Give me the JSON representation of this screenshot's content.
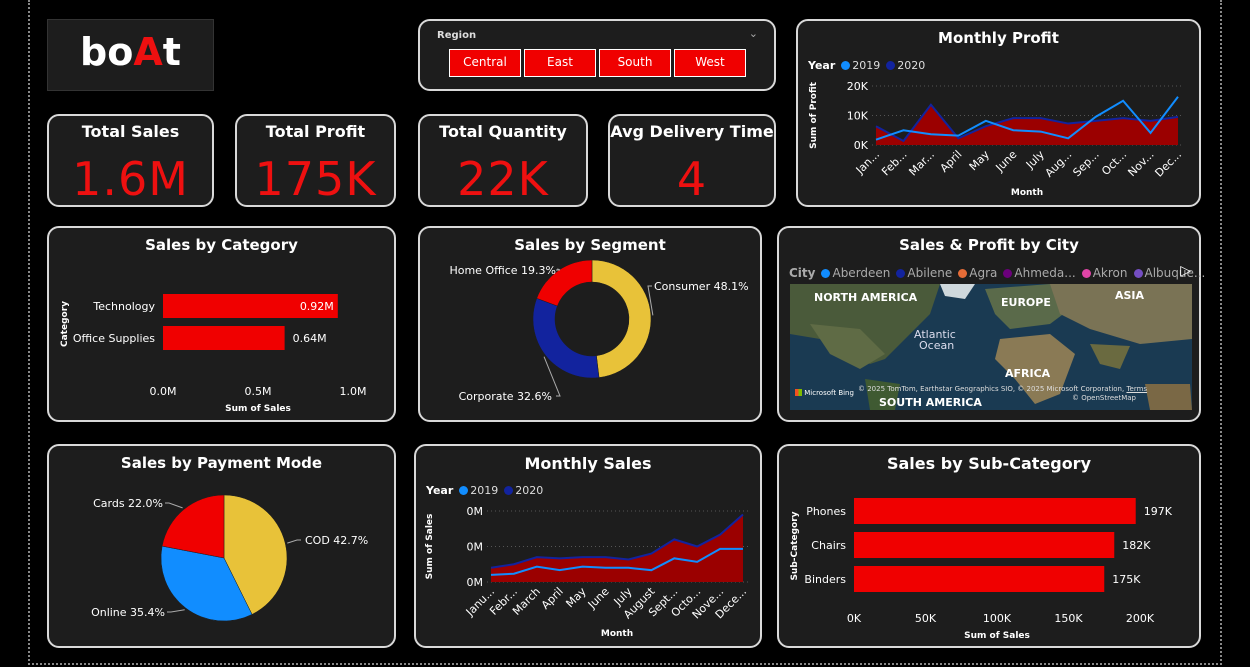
{
  "colors": {
    "red": "#f00000",
    "blue_2019": "#118dff",
    "navy_2020": "#12239e",
    "yellow": "#e8c239",
    "card_bg": "#1d1d1d"
  },
  "logo": {
    "prefix": "bo",
    "accent": "A",
    "suffix": "t"
  },
  "region": {
    "title": "Region",
    "options": [
      "Central",
      "East",
      "South",
      "West"
    ],
    "chevron": "chevron-down-icon"
  },
  "kpis": [
    {
      "label": "Total Sales",
      "value": "1.6M"
    },
    {
      "label": "Total Profit",
      "value": "175K"
    },
    {
      "label": "Total Quantity",
      "value": "22K"
    },
    {
      "label": "Avg Delivery Time",
      "value": "4"
    }
  ],
  "monthly_profit": {
    "title": "Monthly Profit",
    "legend_title": "Year",
    "ylabel": "Sum of Profit",
    "xlabel": "Month"
  },
  "sales_category": {
    "title": "Sales by Category",
    "ylabel": "Category",
    "xlabel": "Sum of Sales"
  },
  "sales_segment": {
    "title": "Sales by Segment"
  },
  "city": {
    "title": "Sales & Profit by City",
    "legend_title": "City",
    "legend": [
      {
        "name": "Aberdeen",
        "color": "#118dff"
      },
      {
        "name": "Abilene",
        "color": "#12239e"
      },
      {
        "name": "Agra",
        "color": "#e66c37"
      },
      {
        "name": "Ahmeda...",
        "color": "#6b007b"
      },
      {
        "name": "Akron",
        "color": "#e044a7"
      },
      {
        "name": "Albuque...",
        "color": "#744ec2"
      }
    ],
    "map_labels": [
      "NORTH AMERICA",
      "EUROPE",
      "ASIA",
      "Atlantic",
      "Ocean",
      "AFRICA",
      "SOUTH AMERICA"
    ],
    "attribution": "© 2025 TomTom, Earthstar Geographics SIO, © 2025 Microsoft Corporation,",
    "terms": "Terms",
    "osm": "© OpenStreetMap",
    "bing": "Microsoft Bing",
    "next_icon": "play-arrow-icon"
  },
  "payment": {
    "title": "Sales by Payment Mode"
  },
  "monthly_sales": {
    "title": "Monthly Sales",
    "legend_title": "Year",
    "ylabel": "Sum of Sales",
    "xlabel": "Month"
  },
  "subcategory": {
    "title": "Sales by Sub-Category",
    "ylabel": "Sub-Category",
    "xlabel": "Sum of Sales"
  },
  "chart_data": [
    {
      "id": "monthly_profit",
      "type": "area",
      "categories": [
        "Jan...",
        "Feb...",
        "Mar...",
        "April",
        "May",
        "June",
        "July",
        "Aug...",
        "Sep...",
        "Oct...",
        "Nov...",
        "Dec..."
      ],
      "series": [
        {
          "name": "2019",
          "values": [
            2000,
            5500,
            4000,
            3500,
            9000,
            5500,
            5000,
            2500,
            10500,
            16500,
            4500,
            18000
          ]
        },
        {
          "name": "2020",
          "values": [
            7000,
            1500,
            15000,
            2500,
            7000,
            10000,
            10000,
            8000,
            9000,
            10000,
            9000,
            10500
          ]
        }
      ],
      "yticks": [
        "0K",
        "10K",
        "20K"
      ],
      "ylim": [
        0,
        22000
      ],
      "title": "Monthly Profit",
      "xlabel": "Month",
      "ylabel": "Sum of Profit"
    },
    {
      "id": "sales_by_category",
      "type": "bar",
      "categories": [
        "Technology",
        "Office Supplies"
      ],
      "values": [
        0.92,
        0.64
      ],
      "value_labels": [
        "0.92M",
        "0.64M"
      ],
      "xticks": [
        "0.0M",
        "0.5M",
        "1.0M"
      ],
      "xlim": [
        0,
        1.0
      ],
      "title": "Sales by Category",
      "xlabel": "Sum of Sales",
      "ylabel": "Category"
    },
    {
      "id": "sales_by_segment",
      "type": "pie",
      "donut": true,
      "labels": [
        "Consumer",
        "Corporate",
        "Home Office"
      ],
      "values": [
        48.1,
        32.6,
        19.3
      ],
      "value_labels": [
        "Consumer 48.1%",
        "Corporate 32.6%",
        "Home Office 19.3%"
      ],
      "title": "Sales by Segment"
    },
    {
      "id": "sales_by_payment_mode",
      "type": "pie",
      "labels": [
        "COD",
        "Online",
        "Cards"
      ],
      "values": [
        42.7,
        35.4,
        22.0
      ],
      "value_labels": [
        "COD 42.7%",
        "Online 35.4%",
        "Cards 22.0%"
      ],
      "title": "Sales by Payment Mode"
    },
    {
      "id": "monthly_sales",
      "type": "area",
      "categories": [
        "Janu...",
        "Febr...",
        "March",
        "April",
        "May",
        "June",
        "July",
        "August",
        "Sept...",
        "Octo...",
        "Nove...",
        "Dece..."
      ],
      "series": [
        {
          "name": "2019",
          "values": [
            0.06,
            0.07,
            0.13,
            0.1,
            0.13,
            0.12,
            0.12,
            0.1,
            0.2,
            0.17,
            0.28,
            0.28
          ]
        },
        {
          "name": "2020",
          "values": [
            0.12,
            0.15,
            0.21,
            0.2,
            0.21,
            0.21,
            0.19,
            0.24,
            0.36,
            0.3,
            0.4,
            0.57
          ]
        }
      ],
      "yticks": [
        "0M",
        "0M",
        "0M"
      ],
      "ylim": [
        0,
        0.6
      ],
      "title": "Monthly Sales",
      "xlabel": "Month",
      "ylabel": "Sum of Sales"
    },
    {
      "id": "sales_by_sub_category",
      "type": "bar",
      "categories": [
        "Phones",
        "Chairs",
        "Binders"
      ],
      "values": [
        197,
        182,
        175
      ],
      "value_labels": [
        "197K",
        "182K",
        "175K"
      ],
      "xticks": [
        "0K",
        "50K",
        "100K",
        "150K",
        "200K"
      ],
      "xlim": [
        0,
        200
      ],
      "title": "Sales by Sub-Category",
      "xlabel": "Sum of Sales",
      "ylabel": "Sub-Category"
    }
  ]
}
